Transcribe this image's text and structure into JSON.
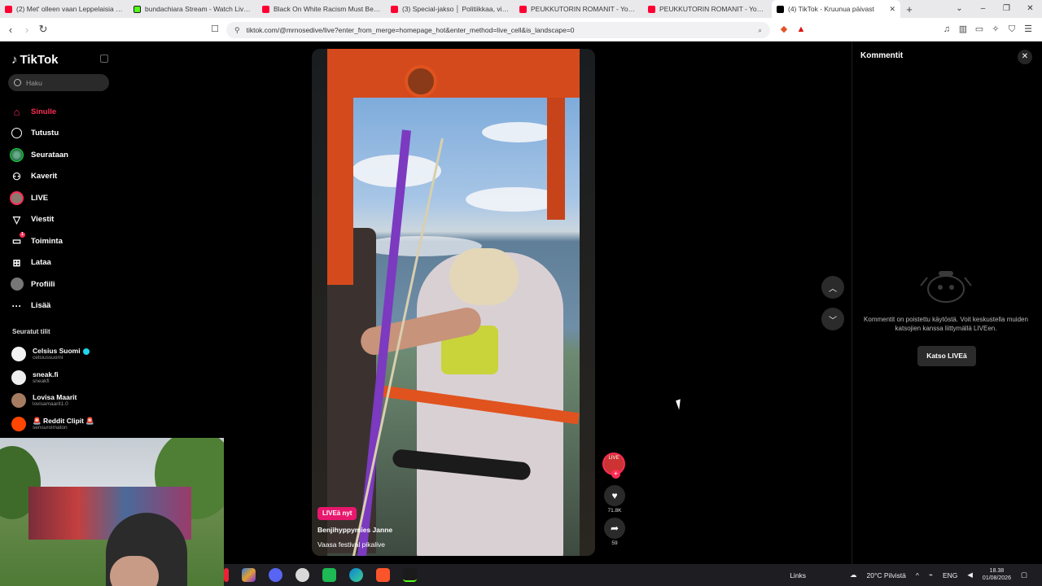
{
  "browser": {
    "tabs": [
      {
        "title": "(2) Met' olleen vaan Leppelaisia (20",
        "favicon": "yt"
      },
      {
        "title": "bundachiara Stream - Watch Live on",
        "favicon": "kick"
      },
      {
        "title": "Black On White Racism Must Be ST",
        "favicon": "yt"
      },
      {
        "title": "(3) Special-jakso │ Politiikkaa, vieran",
        "favicon": "yt"
      },
      {
        "title": "PEUKKUTORIN ROMANIT - YouTube",
        "favicon": "yt"
      },
      {
        "title": "PEUKKUTORIN ROMANIT - YouTube",
        "favicon": "yt"
      },
      {
        "title": "(4) TikTok - Kruunua päivast",
        "favicon": "tt",
        "active": true
      }
    ],
    "new_tab": "+",
    "url": "tiktok.com/@mrnosedive/live?enter_from_merge=homepage_hot&enter_method=live_cell&is_landscape=0"
  },
  "sidebar": {
    "logo": "TikTok",
    "search_placeholder": "Haku",
    "nav": [
      {
        "label": "Sinulle",
        "icon": "home-icon",
        "active": true
      },
      {
        "label": "Tutustu",
        "icon": "compass-icon"
      },
      {
        "label": "Seurataan",
        "icon": "following-avatar-icon"
      },
      {
        "label": "Kaverit",
        "icon": "friends-icon"
      },
      {
        "label": "LIVE",
        "icon": "live-icon"
      },
      {
        "label": "Viestit",
        "icon": "messages-icon"
      },
      {
        "label": "Toiminta",
        "icon": "activity-icon",
        "badge": "1"
      },
      {
        "label": "Lataa",
        "icon": "upload-icon"
      },
      {
        "label": "Profiili",
        "icon": "profile-icon"
      },
      {
        "label": "Lisää",
        "icon": "more-icon"
      }
    ],
    "following_title": "Seuratut tilit",
    "following": [
      {
        "name": "Celsius Suomi",
        "handle": "celsiussuomi",
        "verified": true,
        "color": "#f2f2f2"
      },
      {
        "name": "sneak.fi",
        "handle": "sneakfi",
        "color": "#eeeeee"
      },
      {
        "name": "Lovisa Maarit",
        "handle": "lovisamaarit1.0",
        "color": "#a57b62"
      },
      {
        "name": "🚨 Reddit Clipit 🚨",
        "handle": "sensuroimaton",
        "color": "#ff4500"
      }
    ]
  },
  "video": {
    "live_badge": "LIVEä nyt",
    "author": "Benjihyppymies Janne",
    "description": "Vaasa festival pikalive",
    "avatar_label": "LIVE",
    "like_count": "71.8K",
    "share_count": "59"
  },
  "comments": {
    "title": "Kommentit",
    "message": "Kommentit on poistettu käytöstä. Voit keskustella muiden katsojien kanssa liittymällä LIVEen.",
    "button": "Katso LIVEä"
  },
  "taskbar": {
    "links": "Links",
    "weather": "20°C  Pilvistä",
    "lang": "ENG",
    "time": "18.38",
    "date": "01/08/2026"
  },
  "colors": {
    "accent": "#fe2c55",
    "live_badge": "#e8186e"
  }
}
